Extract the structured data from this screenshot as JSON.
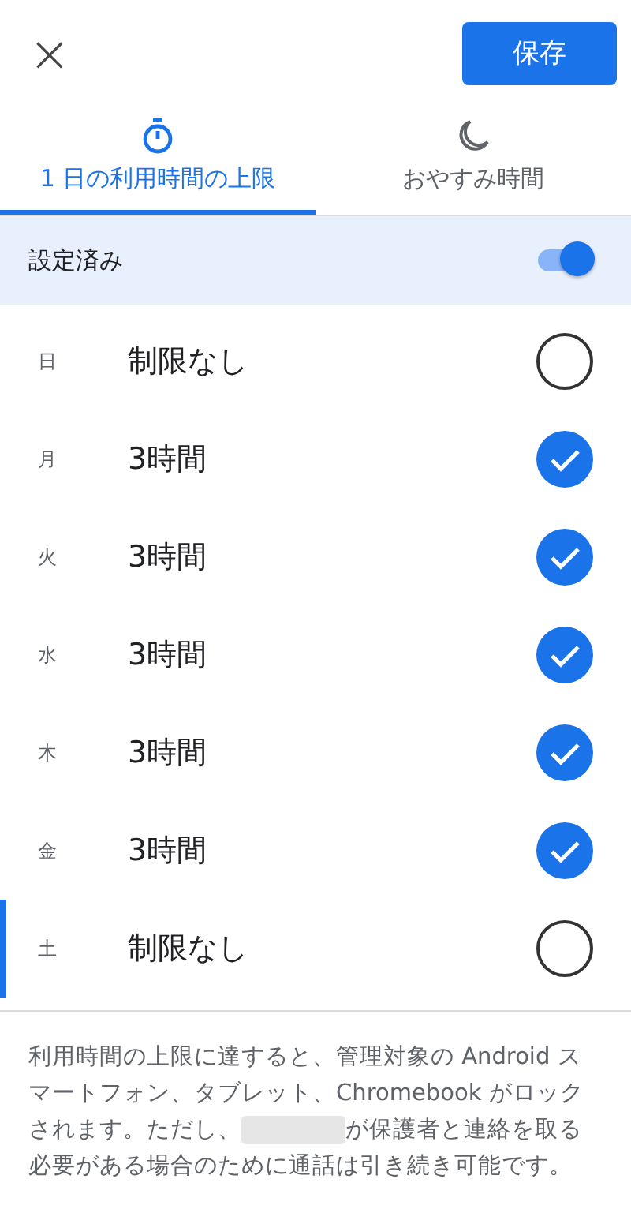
{
  "header": {
    "close": "×",
    "save": "保存"
  },
  "tabs": [
    {
      "label": "1 日の利用時間の上限",
      "kind": "timer",
      "selected": true
    },
    {
      "label": "おやすみ時間",
      "kind": "moon",
      "selected": false
    }
  ],
  "setting": {
    "label": "設定済み",
    "on": true
  },
  "days": [
    {
      "day": "日",
      "limit": "制限なし",
      "checked": false,
      "selected": false
    },
    {
      "day": "月",
      "limit": "3時間",
      "checked": true,
      "selected": false
    },
    {
      "day": "火",
      "limit": "3時間",
      "checked": true,
      "selected": false
    },
    {
      "day": "水",
      "limit": "3時間",
      "checked": true,
      "selected": false
    },
    {
      "day": "木",
      "limit": "3時間",
      "checked": true,
      "selected": false
    },
    {
      "day": "金",
      "limit": "3時間",
      "checked": true,
      "selected": false
    },
    {
      "day": "土",
      "limit": "制限なし",
      "checked": false,
      "selected": true
    }
  ],
  "note": {
    "before": "利用時間の上限に達すると、管理対象の Android スマートフォン、タブレット、Chromebook がロックされます。ただし、",
    "after": "が保護者と連絡を取る必要がある場合のために通話は引き続き可能です。"
  }
}
